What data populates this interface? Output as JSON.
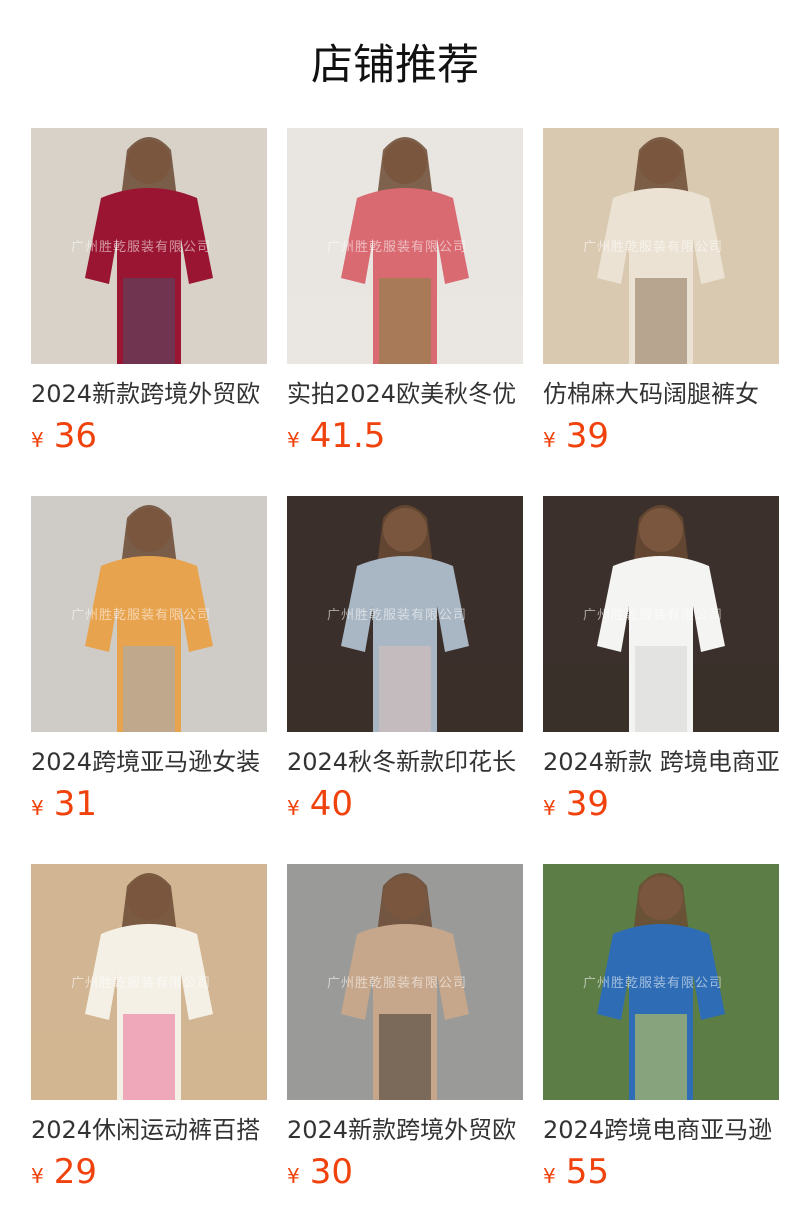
{
  "header": {
    "title": "店铺推荐"
  },
  "watermark": "广州胜乾服装有限公司",
  "currency_symbol": "¥",
  "products": [
    {
      "title": "2024新款跨境外贸欧",
      "price": "36",
      "icon": "red-blouse-photo",
      "colors": {
        "bg": "#d8d2c8",
        "main": "#9a1531",
        "accent": "#3d5a7a"
      }
    },
    {
      "title": "实拍2024欧美秋冬优",
      "price": "41.5",
      "icon": "pink-dress-photo",
      "colors": {
        "bg": "#e9e6e2",
        "main": "#d96a72",
        "accent": "#6f8f3a"
      }
    },
    {
      "title": "仿棉麻大码阔腿裤女",
      "price": "39",
      "icon": "linen-pants-photo",
      "colors": {
        "bg": "#d9c9b0",
        "main": "#ebe2d3",
        "accent": "#7a5a3c"
      }
    },
    {
      "title": "2024跨境亚马逊女装",
      "price": "31",
      "icon": "floral-dress-photo",
      "colors": {
        "bg": "#cfcbc7",
        "main": "#e8a34e",
        "accent": "#8fb0d8"
      }
    },
    {
      "title": "2024秋冬新款印花长",
      "price": "40",
      "icon": "floral-top-photo",
      "colors": {
        "bg": "#3a2f2a",
        "main": "#a9b6c4",
        "accent": "#e3c0b5"
      }
    },
    {
      "title": "2024新款 跨境电商亚",
      "price": "39",
      "icon": "white-top-photo",
      "colors": {
        "bg": "#3b302b",
        "main": "#f4f4f2",
        "accent": "#cfcfcf"
      }
    },
    {
      "title": "2024休闲运动裤百搭",
      "price": "29",
      "icon": "floral-pants-photo",
      "colors": {
        "bg": "#d2b592",
        "main": "#f4f0e6",
        "accent": "#e64f86"
      }
    },
    {
      "title": "2024新款跨境外贸欧",
      "price": "30",
      "icon": "beige-blouse-photo",
      "colors": {
        "bg": "#9a9a98",
        "main": "#c7a78b",
        "accent": "#1f1f1f"
      }
    },
    {
      "title": "2024跨境电商亚马逊",
      "price": "55",
      "icon": "striped-dress-photo",
      "colors": {
        "bg": "#5c7d46",
        "main": "#2e6db5",
        "accent": "#f4e43a"
      }
    }
  ]
}
